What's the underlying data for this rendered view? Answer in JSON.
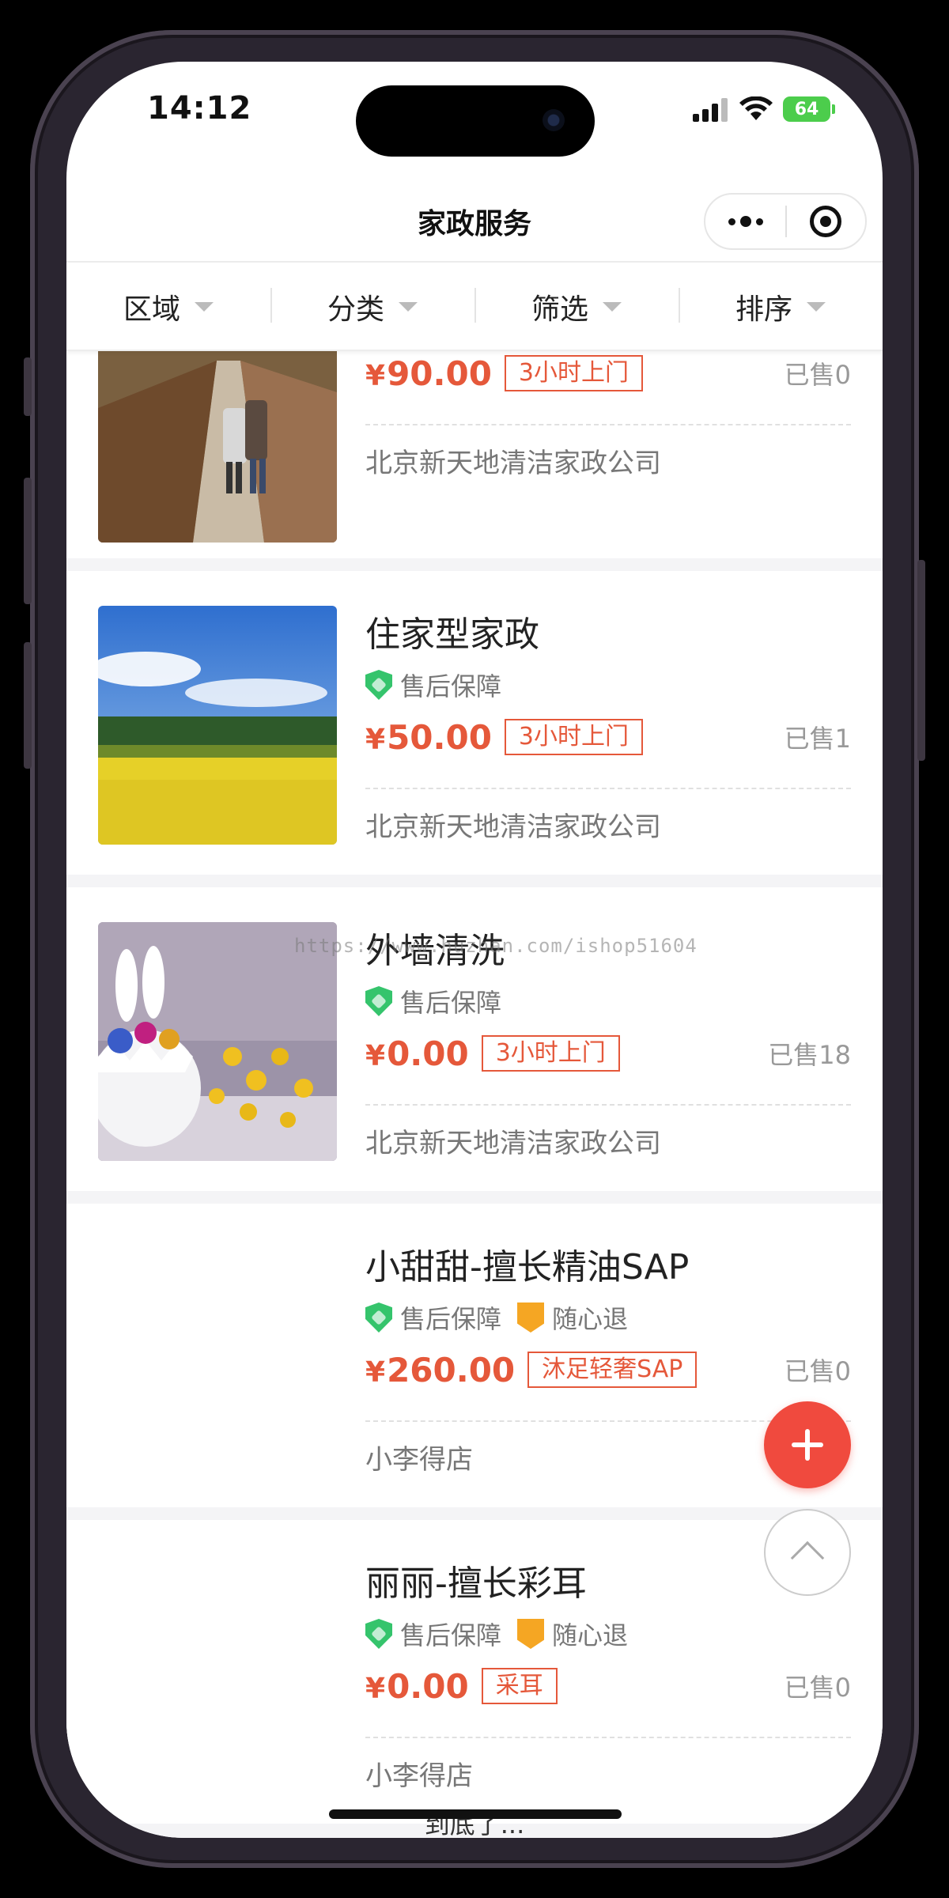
{
  "status_bar": {
    "time": "14:12",
    "battery": "64"
  },
  "nav": {
    "title": "家政服务"
  },
  "filters": [
    {
      "label": "区域"
    },
    {
      "label": "分类"
    },
    {
      "label": "筛选"
    },
    {
      "label": "排序"
    }
  ],
  "items": [
    {
      "title": "",
      "tags": [],
      "price": "90.00",
      "badge": "3小时上门",
      "sold": "已售0",
      "shop": "北京新天地清洁家政公司"
    },
    {
      "title": "住家型家政",
      "tags": [
        "售后保障"
      ],
      "price": "50.00",
      "badge": "3小时上门",
      "sold": "已售1",
      "shop": "北京新天地清洁家政公司"
    },
    {
      "title": "外墙清洗",
      "tags": [
        "售后保障"
      ],
      "price": "0.00",
      "badge": "3小时上门",
      "sold": "已售18",
      "shop": "北京新天地清洁家政公司"
    },
    {
      "title": "小甜甜-擅长精油SAP",
      "tags": [
        "售后保障",
        "随心退"
      ],
      "price": "260.00",
      "badge": "沐足轻奢SAP",
      "sold": "已售0",
      "shop": "小李得店"
    },
    {
      "title": "丽丽-擅长彩耳",
      "tags": [
        "售后保障",
        "随心退"
      ],
      "price": "0.00",
      "badge": "采耳",
      "sold": "已售0",
      "shop": "小李得店"
    }
  ],
  "currency_symbol": "¥",
  "footer": {
    "end_text": "到底了..."
  },
  "watermark": "https://www.huzhan.com/ishop51604",
  "colors": {
    "price": "#e5583a",
    "fab": "#f04a3e",
    "shield": "#35c46c",
    "refund": "#f5a623"
  }
}
